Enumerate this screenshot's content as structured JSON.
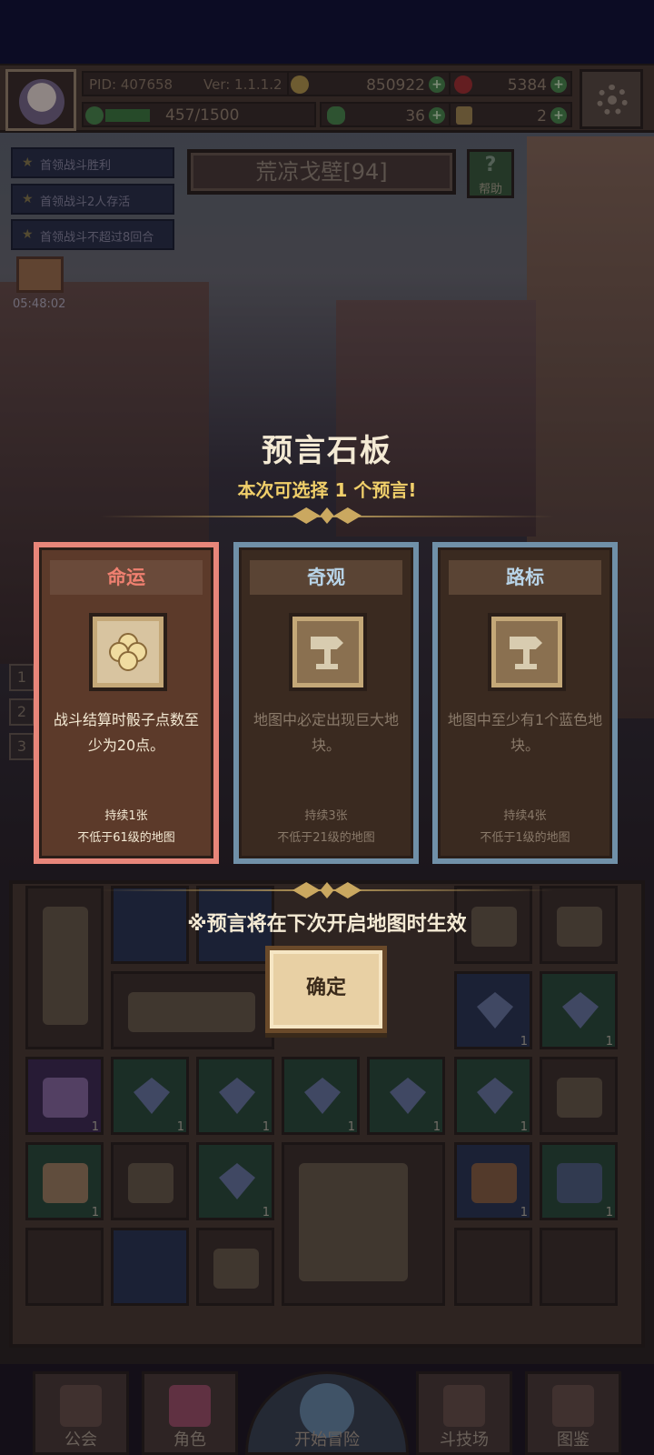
{
  "header": {
    "pid": "PID: 407658",
    "version": "Ver: 1.1.1.2",
    "gold": "850922",
    "apples": "5384",
    "energy": "457/1500",
    "energy_fraction": 0.305,
    "clovers": "36",
    "thumbs": "2"
  },
  "quests": [
    "首领战斗胜利",
    "首领战斗2人存活",
    "首领战斗不超过8回合"
  ],
  "chest_timer": "05:48:02",
  "map": {
    "name": "荒凉戈壁[94]",
    "help_label": "帮助"
  },
  "side_buttons": [
    "1",
    "2",
    "3"
  ],
  "modal": {
    "title": "预言石板",
    "subtitle": "本次可选择 1 个预言!",
    "cards": [
      {
        "name": "命运",
        "icon": "clover-icon",
        "desc": "战斗结算时骰子点数至少为20点。",
        "duration": "持续1张",
        "level": "不低于61级的地图",
        "selected": true
      },
      {
        "name": "奇观",
        "icon": "signpost-icon",
        "desc": "地图中必定出现巨大地块。",
        "duration": "持续3张",
        "level": "不低于21级的地图",
        "selected": false
      },
      {
        "name": "路标",
        "icon": "signpost-icon",
        "desc": "地图中至少有1个蓝色地块。",
        "duration": "持续4张",
        "level": "不低于1级的地图",
        "selected": false
      }
    ],
    "notice": "※预言将在下次开启地图时生效",
    "confirm_label": "确定"
  },
  "inventory_counts": {
    "r2c5": "1",
    "r2c6": "1",
    "r3c1": "1",
    "r3c2": "1",
    "r3c3": "1",
    "r3c4": "1",
    "r3c5": "1",
    "r3c6": "1",
    "r4c1": "1",
    "r4c3": "1",
    "r4c6": "1",
    "r4c7": "1"
  },
  "nav": {
    "guild": "公会",
    "role": "角色",
    "adventure": "开始冒险",
    "arena": "斗技场",
    "codex": "图鉴"
  },
  "colors": {
    "fate_border": "#e8867a",
    "other_border": "#7090a8",
    "subtitle": "#f0cf6a"
  }
}
